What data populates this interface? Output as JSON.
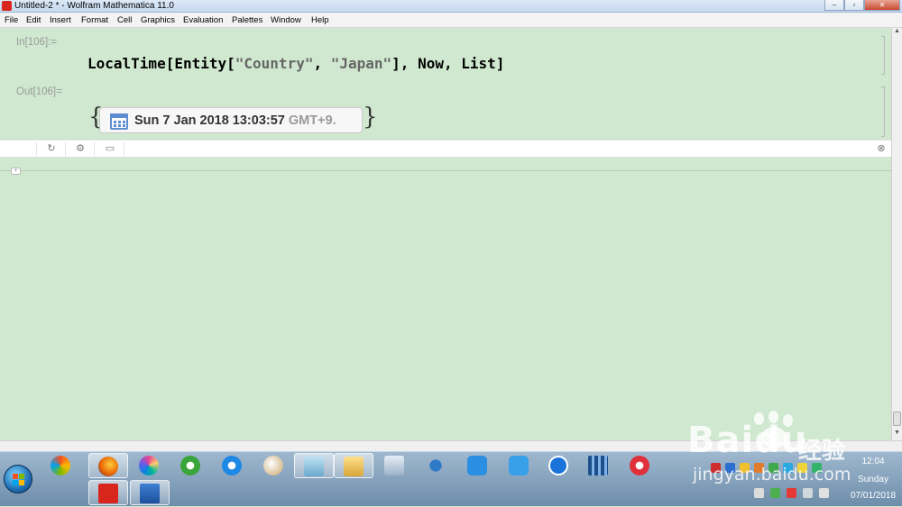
{
  "window": {
    "title": "Untitled-2 * - Wolfram Mathematica 11.0",
    "controls": [
      "–",
      "▫",
      "✕"
    ]
  },
  "menu": [
    "File",
    "Edit",
    "Insert",
    "Format",
    "Cell",
    "Graphics",
    "Evaluation",
    "Palettes",
    "Window",
    "Help"
  ],
  "cells": {
    "input_label": "In[106]:=",
    "input_code": {
      "p1": "LocalTime[Entity[",
      "s1": "\"Country\"",
      "p2": ", ",
      "s2": "\"Japan\"",
      "p3": "], Now, List]"
    },
    "output_label": "Out[106]=",
    "output_open": "{",
    "output_close": "}",
    "date_value": "Sun 7 Jan 2018 13:03:57",
    "date_zone": "GMT+9."
  },
  "toolbar_icons": [
    "refresh-icon",
    "gear-icon",
    "comment-icon",
    "close-icon"
  ],
  "taskbar": {
    "apps": [
      "firefox-icon",
      "colors-icon",
      "ie-green-icon",
      "internet-explorer-icon",
      "paint-icon",
      "stickynotes-icon",
      "file-explorer-icon",
      "calculator-icon",
      "bird-icon",
      "cloud-icon",
      "edit-icon",
      "k-icon",
      "film-icon",
      "play-icon",
      "mathematica-icon",
      "word-icon"
    ],
    "clock_time": "12:04",
    "clock_day": "Sunday",
    "clock_date": "07/01/2018",
    "colors": {
      "taskbar": "#6e8daa",
      "mathematica": "#d9261c"
    }
  },
  "watermark": {
    "brand": "Baidu",
    "brand_cn": "经验",
    "url": "jingyan.baidu.com"
  }
}
